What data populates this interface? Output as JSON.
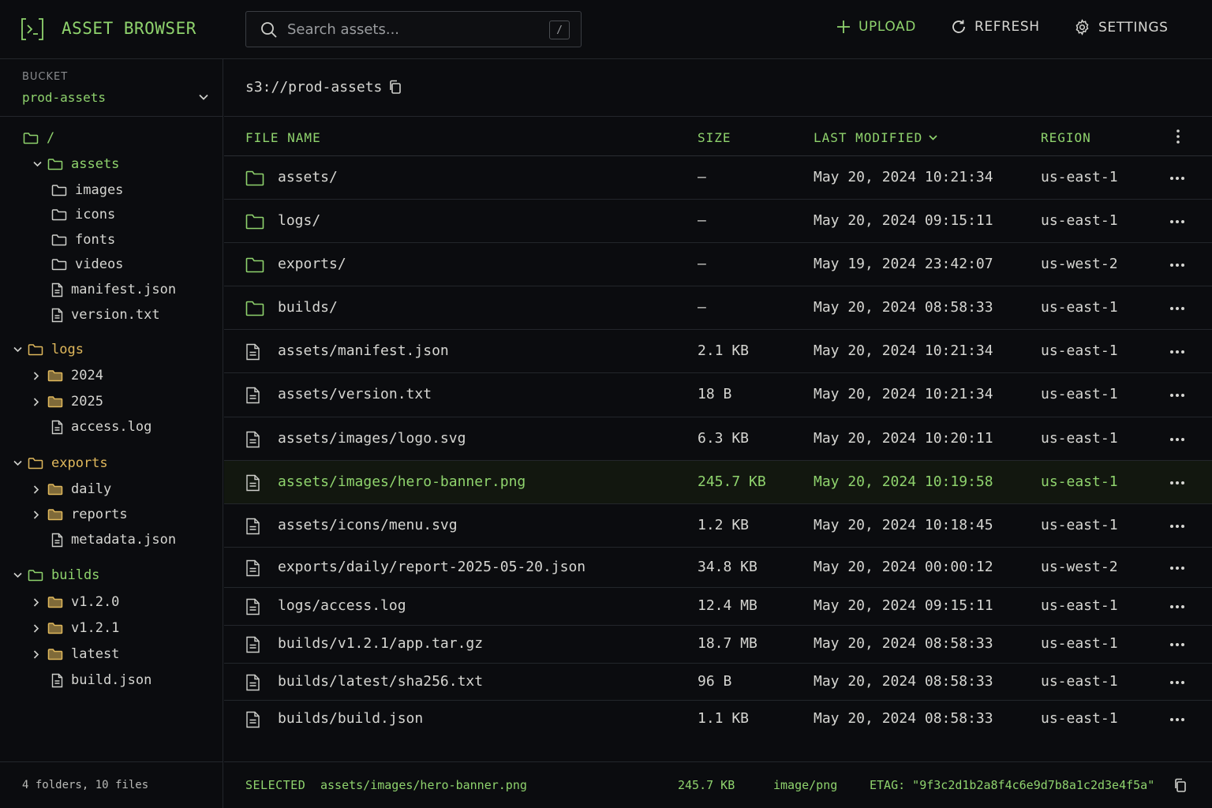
{
  "header": {
    "title": "ASSET BROWSER",
    "search_placeholder": "Search assets...",
    "search_shortcut": "/",
    "upload_label": "UPLOAD",
    "refresh_label": "REFRESH",
    "settings_label": "SETTINGS"
  },
  "sidebar": {
    "bucket_label": "BUCKET",
    "bucket_value": "prod-assets",
    "tree": [
      {
        "label": "/",
        "kind": "folder",
        "depth": 0,
        "expander": "none",
        "color": "green"
      },
      {
        "label": "assets",
        "kind": "folder",
        "depth": 1,
        "expander": "open",
        "color": "green"
      },
      {
        "label": "images",
        "kind": "folder",
        "depth": 2,
        "expander": "none",
        "color": "plain"
      },
      {
        "label": "icons",
        "kind": "folder",
        "depth": 2,
        "expander": "none",
        "color": "plain"
      },
      {
        "label": "fonts",
        "kind": "folder",
        "depth": 2,
        "expander": "none",
        "color": "plain"
      },
      {
        "label": "videos",
        "kind": "folder",
        "depth": 2,
        "expander": "none",
        "color": "plain"
      },
      {
        "label": "manifest.json",
        "kind": "file",
        "depth": 2,
        "expander": "none",
        "color": "plain"
      },
      {
        "label": "version.txt",
        "kind": "file",
        "depth": 2,
        "expander": "none",
        "color": "plain"
      },
      {
        "label": "logs",
        "kind": "folder",
        "depth": 0,
        "expander": "open",
        "color": "amber"
      },
      {
        "label": "2024",
        "kind": "folder",
        "depth": 1,
        "expander": "closed",
        "color": "amber-icon"
      },
      {
        "label": "2025",
        "kind": "folder",
        "depth": 1,
        "expander": "closed",
        "color": "amber-icon"
      },
      {
        "label": "access.log",
        "kind": "file",
        "depth": 2,
        "expander": "none",
        "color": "plain"
      },
      {
        "label": "exports",
        "kind": "folder",
        "depth": 0,
        "expander": "open",
        "color": "amber"
      },
      {
        "label": "daily",
        "kind": "folder",
        "depth": 1,
        "expander": "closed",
        "color": "amber-icon"
      },
      {
        "label": "reports",
        "kind": "folder",
        "depth": 1,
        "expander": "closed",
        "color": "amber-icon"
      },
      {
        "label": "metadata.json",
        "kind": "file",
        "depth": 2,
        "expander": "none",
        "color": "plain"
      },
      {
        "label": "builds",
        "kind": "folder",
        "depth": 0,
        "expander": "open",
        "color": "green"
      },
      {
        "label": "v1.2.0",
        "kind": "folder",
        "depth": 1,
        "expander": "closed",
        "color": "amber-icon"
      },
      {
        "label": "v1.2.1",
        "kind": "folder",
        "depth": 1,
        "expander": "closed",
        "color": "amber-icon"
      },
      {
        "label": "latest",
        "kind": "folder",
        "depth": 1,
        "expander": "closed",
        "color": "amber-icon"
      },
      {
        "label": "build.json",
        "kind": "file",
        "depth": 2,
        "expander": "none",
        "color": "plain"
      }
    ],
    "footer_summary": "4 folders, 10 files"
  },
  "main": {
    "path": "s3://prod-assets",
    "columns": {
      "name": "FILE NAME",
      "size": "SIZE",
      "modified": "LAST MODIFIED",
      "region": "REGION"
    },
    "rows": [
      {
        "kind": "folder",
        "name": "assets/",
        "size": "–",
        "modified": "May 20, 2024 10:21:34",
        "region": "us-east-1",
        "selected": false
      },
      {
        "kind": "folder",
        "name": "logs/",
        "size": "–",
        "modified": "May 20, 2024 09:15:11",
        "region": "us-east-1",
        "selected": false
      },
      {
        "kind": "folder",
        "name": "exports/",
        "size": "–",
        "modified": "May 19, 2024 23:42:07",
        "region": "us-west-2",
        "selected": false
      },
      {
        "kind": "folder",
        "name": "builds/",
        "size": "–",
        "modified": "May 20, 2024 08:58:33",
        "region": "us-east-1",
        "selected": false
      },
      {
        "kind": "file",
        "name": "assets/manifest.json",
        "size": "2.1 KB",
        "modified": "May 20, 2024 10:21:34",
        "region": "us-east-1",
        "selected": false
      },
      {
        "kind": "file",
        "name": "assets/version.txt",
        "size": "18 B",
        "modified": "May 20, 2024 10:21:34",
        "region": "us-east-1",
        "selected": false
      },
      {
        "kind": "file",
        "name": "assets/images/logo.svg",
        "size": "6.3 KB",
        "modified": "May 20, 2024 10:20:11",
        "region": "us-east-1",
        "selected": false
      },
      {
        "kind": "file",
        "name": "assets/images/hero-banner.png",
        "size": "245.7 KB",
        "modified": "May 20, 2024 10:19:58",
        "region": "us-east-1",
        "selected": true
      },
      {
        "kind": "file",
        "name": "assets/icons/menu.svg",
        "size": "1.2 KB",
        "modified": "May 20, 2024 10:18:45",
        "region": "us-east-1",
        "selected": false
      },
      {
        "kind": "file",
        "name": "exports/daily/report-2025-05-20.json",
        "size": "34.8 KB",
        "modified": "May 20, 2024 00:00:12",
        "region": "us-west-2",
        "selected": false
      },
      {
        "kind": "file",
        "name": "logs/access.log",
        "size": "12.4 MB",
        "modified": "May 20, 2024 09:15:11",
        "region": "us-east-1",
        "selected": false
      },
      {
        "kind": "file",
        "name": "builds/v1.2.1/app.tar.gz",
        "size": "18.7 MB",
        "modified": "May 20, 2024 08:58:33",
        "region": "us-east-1",
        "selected": false
      },
      {
        "kind": "file",
        "name": "builds/latest/sha256.txt",
        "size": "96 B",
        "modified": "May 20, 2024 08:58:33",
        "region": "us-east-1",
        "selected": false
      },
      {
        "kind": "file",
        "name": "builds/build.json",
        "size": "1.1 KB",
        "modified": "May 20, 2024 08:58:33",
        "region": "us-east-1",
        "selected": false
      }
    ]
  },
  "statusbar": {
    "selected_label": "SELECTED",
    "selected_path": "assets/images/hero-banner.png",
    "selected_size": "245.7 KB",
    "selected_type": "image/png",
    "etag": "ETAG: \"9f3c2d1b2a8f4c6e9d7b8a1c2d3e4f5a\""
  },
  "colors": {
    "accent_green": "#8fd36d",
    "folder_amber": "#e0b85c",
    "background": "#0b0c0f",
    "selected_row": "#12170f"
  }
}
